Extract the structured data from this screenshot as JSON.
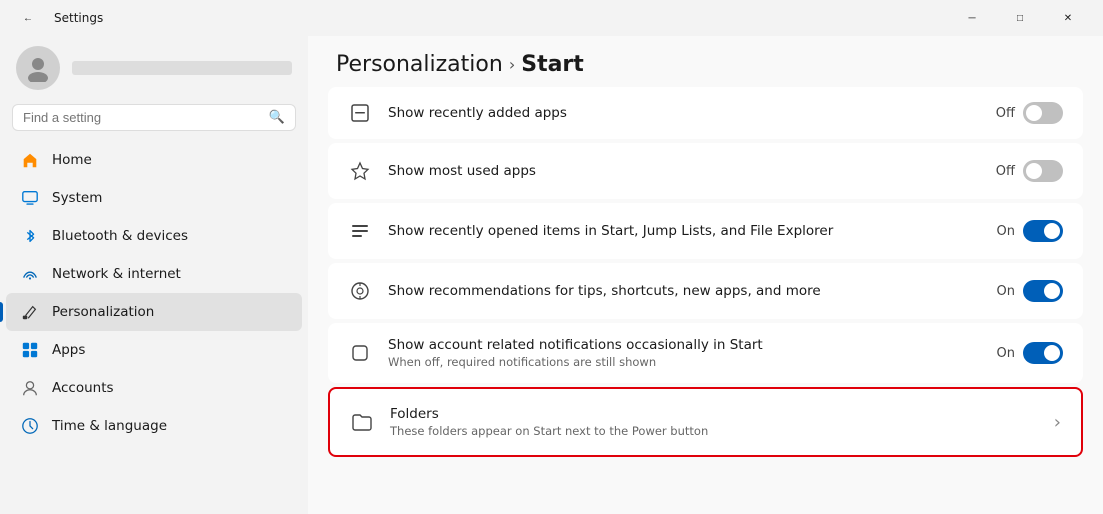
{
  "titleBar": {
    "title": "Settings",
    "backIcon": "←",
    "minimizeIcon": "─",
    "maximizeIcon": "□",
    "closeIcon": "✕"
  },
  "sidebar": {
    "searchPlaceholder": "Find a setting",
    "navItems": [
      {
        "id": "home",
        "label": "Home",
        "icon": "🏠",
        "active": false
      },
      {
        "id": "system",
        "label": "System",
        "icon": "💻",
        "active": false
      },
      {
        "id": "bluetooth",
        "label": "Bluetooth & devices",
        "icon": "🔷",
        "active": false
      },
      {
        "id": "network",
        "label": "Network & internet",
        "icon": "🌐",
        "active": false
      },
      {
        "id": "personalization",
        "label": "Personalization",
        "icon": "✏️",
        "active": true
      },
      {
        "id": "apps",
        "label": "Apps",
        "icon": "📦",
        "active": false
      },
      {
        "id": "accounts",
        "label": "Accounts",
        "icon": "👤",
        "active": false
      },
      {
        "id": "time",
        "label": "Time & language",
        "icon": "🌍",
        "active": false
      }
    ]
  },
  "content": {
    "breadcrumb": {
      "parent": "Personalization",
      "separator": "›",
      "current": "Start"
    },
    "settingGroups": [
      {
        "id": "group1",
        "rows": [
          {
            "id": "recently-added",
            "icon": "⊟",
            "title": "Show recently added apps",
            "subtitle": "",
            "controlType": "toggle",
            "toggleState": "off",
            "toggleLabel": "Off",
            "partial": true
          }
        ]
      },
      {
        "id": "group2",
        "rows": [
          {
            "id": "most-used",
            "icon": "☆",
            "title": "Show most used apps",
            "subtitle": "",
            "controlType": "toggle",
            "toggleState": "off",
            "toggleLabel": "Off"
          }
        ]
      },
      {
        "id": "group3",
        "rows": [
          {
            "id": "recently-opened",
            "icon": "≡",
            "title": "Show recently opened items in Start, Jump Lists, and File Explorer",
            "subtitle": "",
            "controlType": "toggle",
            "toggleState": "on",
            "toggleLabel": "On"
          }
        ]
      },
      {
        "id": "group4",
        "rows": [
          {
            "id": "recommendations",
            "icon": "💡",
            "title": "Show recommendations for tips, shortcuts, new apps, and more",
            "subtitle": "",
            "controlType": "toggle",
            "toggleState": "on",
            "toggleLabel": "On"
          }
        ]
      },
      {
        "id": "group5",
        "rows": [
          {
            "id": "account-notifications",
            "icon": "□",
            "title": "Show account related notifications occasionally in Start",
            "subtitle": "When off, required notifications are still shown",
            "controlType": "toggle",
            "toggleState": "on",
            "toggleLabel": "On"
          }
        ]
      }
    ],
    "foldersItem": {
      "id": "folders",
      "icon": "□",
      "title": "Folders",
      "subtitle": "These folders appear on Start next to the Power button",
      "chevron": "›"
    }
  }
}
